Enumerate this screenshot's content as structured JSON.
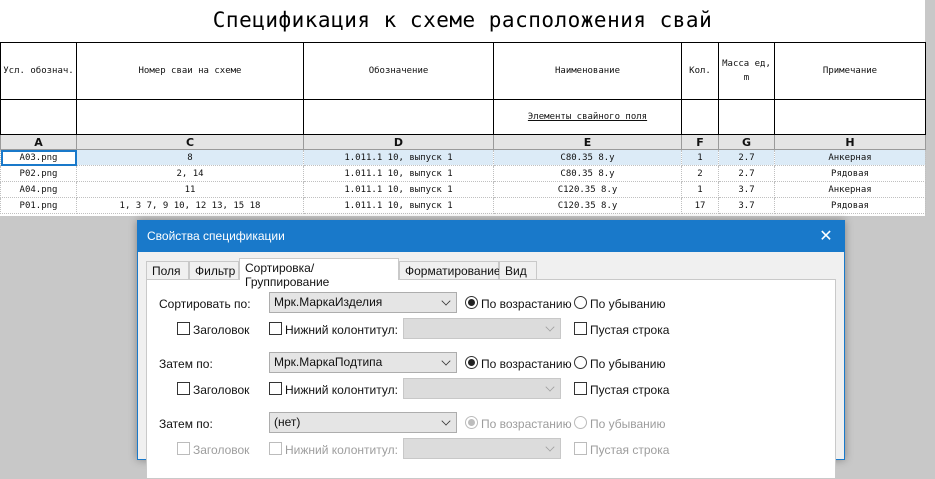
{
  "schedule": {
    "title": "Спецификация к схеме расположения свай",
    "headers": [
      "Усл. обознач.",
      "Номер сваи на схеме",
      "Обозначение",
      "Наименование",
      "Кол.",
      "Масса ед, m",
      "Примечание"
    ],
    "group_label": "Элементы свайного поля",
    "column_letters": [
      "A",
      "C",
      "D",
      "E",
      "F",
      "G",
      "H"
    ],
    "rows": [
      {
        "a": "A03.png",
        "c": "8",
        "d": "1.011.1 10, выпуск 1",
        "e": "С80.35 8.у",
        "f": "1",
        "g": "2.7",
        "h": "Анкерная"
      },
      {
        "a": "P02.png",
        "c": "2, 14",
        "d": "1.011.1 10, выпуск 1",
        "e": "С80.35 8.у",
        "f": "2",
        "g": "2.7",
        "h": "Рядовая"
      },
      {
        "a": "A04.png",
        "c": "11",
        "d": "1.011.1 10, выпуск 1",
        "e": "С120.35 8.у",
        "f": "1",
        "g": "3.7",
        "h": "Анкерная"
      },
      {
        "a": "P01.png",
        "c": "1, 3 7, 9 10, 12 13, 15 18",
        "d": "1.011.1 10, выпуск 1",
        "e": "С120.35 8.у",
        "f": "17",
        "g": "3.7",
        "h": "Рядовая"
      }
    ]
  },
  "dialog": {
    "title": "Свойства спецификации",
    "close_glyph": "✕",
    "tabs": [
      "Поля",
      "Фильтр",
      "Сортировка/Группирование",
      "Форматирование",
      "Вид"
    ],
    "active_tab": "Сортировка/Группирование",
    "sort1": {
      "label": "Сортировать по:",
      "field": "Мрк.МаркаИзделия",
      "asc": "По возрастанию",
      "desc": "По убыванию",
      "header": "Заголовок",
      "footer": "Нижний колонтитул:",
      "blank": "Пустая строка"
    },
    "sort2": {
      "label": "Затем по:",
      "field": "Мрк.МаркаПодтипа",
      "asc": "По возрастанию",
      "desc": "По убыванию",
      "header": "Заголовок",
      "footer": "Нижний колонтитул:",
      "blank": "Пустая строка"
    },
    "sort3": {
      "label": "Затем по:",
      "field": "(нет)",
      "asc": "По возрастанию",
      "desc": "По убыванию",
      "header": "Заголовок",
      "footer": "Нижний колонтитул:",
      "blank": "Пустая строка"
    }
  },
  "colors": {
    "accent": "#1979ca",
    "selection": "#dcebf7",
    "background": "#c8c8c8"
  }
}
